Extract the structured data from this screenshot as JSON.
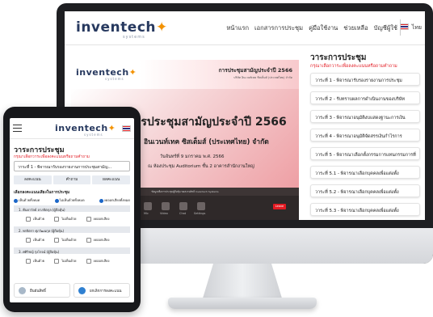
{
  "brand": {
    "name_a": "inven",
    "name_b": "tech",
    "tagline": "systems",
    "accent": "#f39200",
    "navy": "#27395f"
  },
  "desktop": {
    "nav": [
      "หน้าแรก",
      "เอกสารการประชุม",
      "คู่มือใช้งาน",
      "ช่วยเหลือ",
      "บัญชีผู้ใช้"
    ],
    "lang": "ไทย",
    "video": {
      "header_title": "การประชุมสามัญประจำปี 2566",
      "header_sub": "บริษัท อินเวนท์เทค ซิสเต็มส์ (ประเทศไทย) จำกัด",
      "slide_title": "การประชุมสามัญประจำปี 2566",
      "slide_company": "อินเวนท์เทค ซิสเต็มส์ (ประเทศไทย) จำกัด",
      "slide_date": "วันจันทร์ที่ 9 มกราคม พ.ศ. 2566",
      "slide_venue": "ณ ห้องประชุม Auditorium ชั้น 2 อาคารสำนักงานใหญ่",
      "caption": "ข้อมูลเพื่อการประชุมผู้ถือหุ้น ขอสงวนสิทธิ์ Inventech Systems",
      "controls": [
        "Mic",
        "Video",
        "Chat",
        "Settings"
      ],
      "leave": "Leave",
      "footer": "All rights reserved"
    },
    "agenda": {
      "title": "วาระการประชุม",
      "note": "กรุณาเลือกวาระเพื่อลงคะแนนหรือถามคำถาม",
      "items": [
        "วาระที่ 1 - พิจารณารับรองรายงานการประชุม",
        "วาระที่ 2 - รับทราบผลการดำเนินงานของบริษัท",
        "วาระที่ 3 - พิจารณาอนุมัติงบแสดงฐานะการเงิน",
        "วาระที่ 4 - พิจารณาอนุมัติจัดสรรเงินกำไรการ",
        "วาระที่ 5 - พิจารณาเลือกตั้งกรรมการแทนกรรมการที่",
        "วาระที่ 5.1 - พิจารณาเลือกบุคคลเพื่อแต่งตั้ง",
        "วาระที่ 5.2 - พิจารณาเลือกบุคคลเพื่อแต่งตั้ง",
        "วาระที่ 5.3 - พิจารณาเลือกบุคคลเพื่อแต่งตั้ง"
      ]
    }
  },
  "tablet": {
    "lang": "ไทย",
    "title": "วาระการประชุม",
    "note": "กรุณาเลือกวาระเพื่อลงคะแนนหรือถามคำถาม",
    "selected_agenda": "วาระที่ 1 - พิจารณารับรองรายงานการประชุมสามัญ...",
    "tabs": [
      "ลงคะแนน",
      "คำถาม",
      "ผลคะแนน"
    ],
    "section_label": "เลือกลงคะแนนเสียงในการประชุม",
    "radios": [
      "เห็นด้วยทั้งหมด",
      "ไม่เห็นด้วยทั้งหมด",
      "งดออกเสียงทั้งหมด"
    ],
    "groups": [
      {
        "label": "1. คืนธาวัลย์ ลาภจิตกุล (ผู้ถือหุ้น)"
      },
      {
        "label": "2. พรจิตรา ศุภวัฒนกุล (ผู้ถือหุ้น)"
      },
      {
        "label": "3. ศศิวิชญ์ รุ่งโรจน์ (ผู้ถือหุ้น)"
      }
    ],
    "options": [
      "เห็นด้วย",
      "ไม่เห็นด้วย",
      "งดออกเสียง"
    ],
    "footer": [
      "ยืนยันสิทธิ์",
      "ยกเลิกการลงคะแนน"
    ]
  }
}
